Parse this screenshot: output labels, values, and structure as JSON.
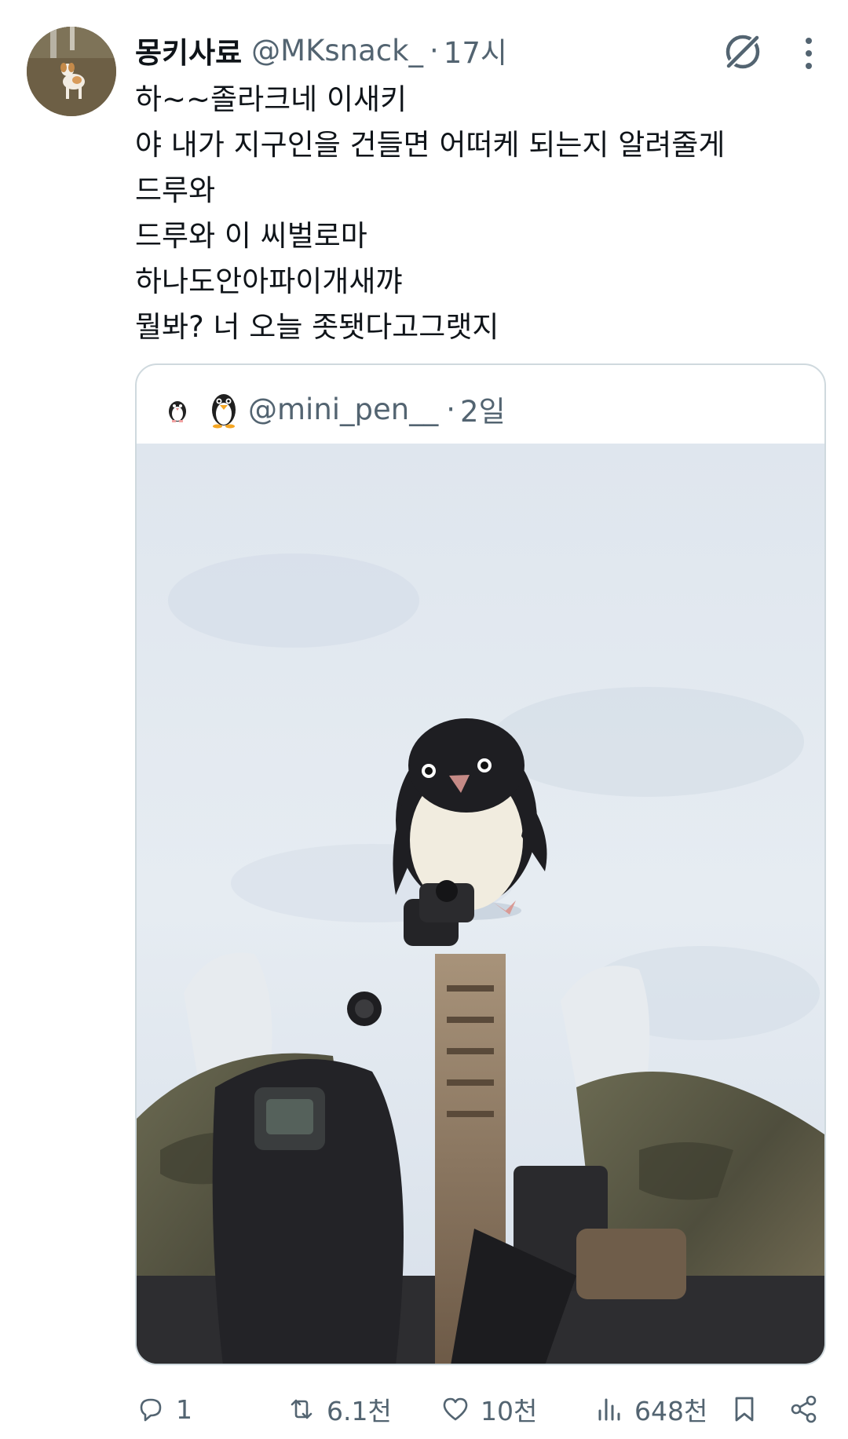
{
  "tweet": {
    "display_name": "몽키사료",
    "handle": "@MKsnack_",
    "separator": "·",
    "time": "17시",
    "lines": [
      "하~~졸라크네 이새키",
      "야 내가 지구인을 건들면 어떠케 되는지 알려줄게",
      "드루와",
      "드루와 이 씨벌로마",
      "하나도안아파이개새꺄",
      "뭘봐? 너 오늘 좃됏다고그랫지"
    ]
  },
  "quote": {
    "handle": "@mini_pen__",
    "separator": "·",
    "time": "2일"
  },
  "actions": {
    "reply_count": "1",
    "retweet_count": "6.1천",
    "like_count": "10천",
    "views_count": "648천"
  },
  "icons": {
    "header": [
      "grok-icon",
      "more-icon"
    ],
    "actions": [
      "reply-icon",
      "retweet-icon",
      "like-icon",
      "views-icon",
      "bookmark-icon",
      "share-icon"
    ]
  },
  "colors": {
    "text": "#0f1419",
    "secondary": "#536471",
    "border": "#cfd9de",
    "snow": "#e4ebf2"
  }
}
